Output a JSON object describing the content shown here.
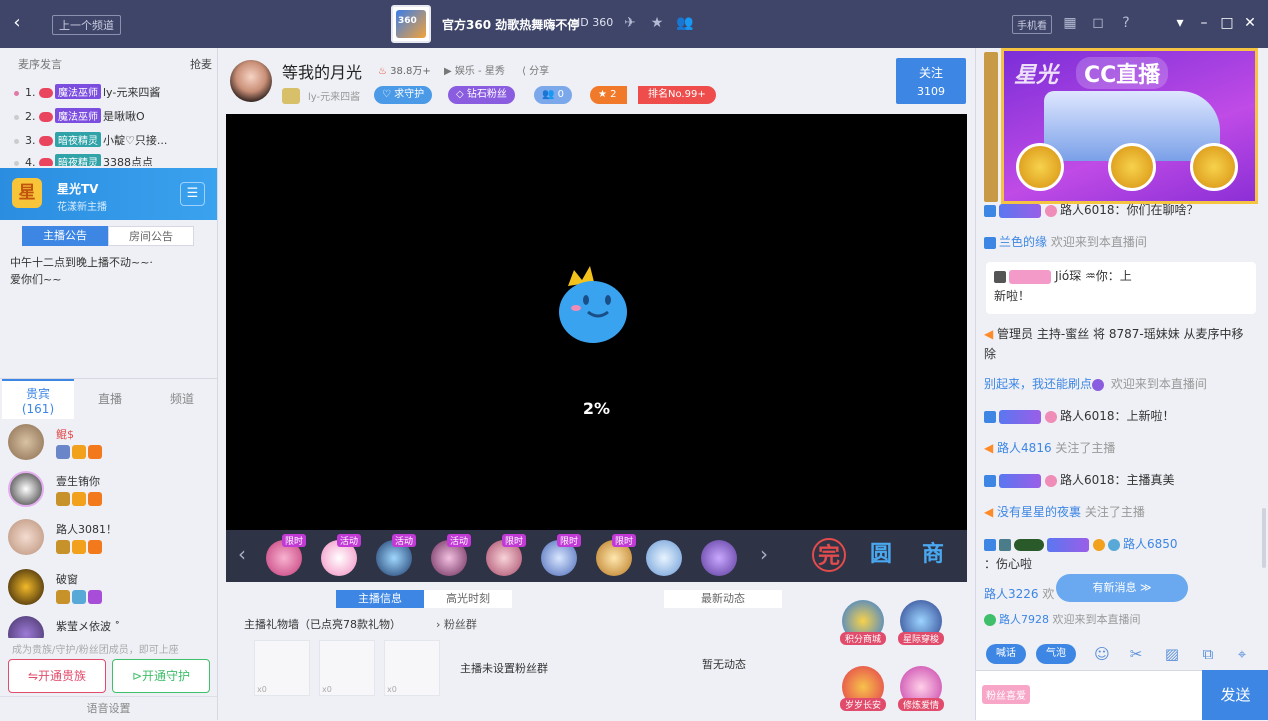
{
  "titlebar": {
    "back_icon": "chevron-left-icon",
    "prev_channel": "上一个频道",
    "logo_text": "360",
    "title": "官方360 劲歌热舞嗨不停",
    "room_id": "ID 360",
    "phone_btn": "手机看",
    "icons": [
      "plane-icon",
      "star-icon",
      "users-icon",
      "grid-icon",
      "bell-icon",
      "help-icon",
      "dropdown-icon",
      "minimize-icon",
      "maximize-icon",
      "close-icon"
    ]
  },
  "left": {
    "rank_header": "麦序发言",
    "rank_grab": "抢麦",
    "rank": [
      {
        "num": "1.",
        "badge": "魔法巫师",
        "name": "ly-元来四酱"
      },
      {
        "num": "2.",
        "badge": "魔法巫师",
        "name": "是啾啾O"
      },
      {
        "num": "3.",
        "badge": "暗夜精灵",
        "name": "小靛♡只接..."
      },
      {
        "num": "4.",
        "badge": "暗夜精灵",
        "name": "3388点点"
      }
    ],
    "banner": {
      "logo": "星",
      "name": "星光TV",
      "sub": "花漾新主播"
    },
    "tabs": [
      "主播公告",
      "房间公告"
    ],
    "notice": "中午十二点到晚上播不动~~·\n爱你们~~",
    "vtabs": [
      {
        "l1": "贵宾",
        "l2": "(161)"
      },
      {
        "l1": "直播"
      },
      {
        "l1": "频道"
      }
    ],
    "members": [
      {
        "name": "鲲$",
        "red": true
      },
      {
        "name": "壹生铕你",
        "red": false
      },
      {
        "name": "路人3081！",
        "red": false
      },
      {
        "name": "破窗",
        "red": false
      },
      {
        "name": "紫莹メ依波 ˚",
        "red": false
      }
    ],
    "join_tip": "成为贵族/守护/粉丝团成员，即可上座",
    "btn_family": "开通贵族",
    "btn_guard": "开通守护",
    "voice": "语音设置"
  },
  "anchor": {
    "name": "等我的月光",
    "hot": "38.8万+",
    "category": "娱乐 - 星秀",
    "share": "分享",
    "sub": "ly-元来四酱",
    "pills": [
      "求守护",
      "钻石粉丝",
      "0",
      "2",
      "排名No.99+"
    ],
    "follow": "关注",
    "follow_count": "3109"
  },
  "video": {
    "progress": "2%"
  },
  "gifts": {
    "tags": [
      "限时",
      "活动",
      "活动",
      "活动",
      "限时",
      "限时",
      "限时"
    ],
    "right_icons": [
      "完",
      "圆",
      "商"
    ]
  },
  "info": {
    "tabs": [
      "主播信息",
      "高光时刻"
    ],
    "gift_wall": "主播礼物墙（已点亮78款礼物）",
    "fans": "粉丝群",
    "no_fan": "主播未设置粉丝群",
    "news_tab": "最新动态",
    "no_news": "暂无动态",
    "thumbs": [
      "x0",
      "x0",
      "x0"
    ]
  },
  "apps": [
    "积分商城",
    "星际穿梭",
    "岁岁长安",
    "修炼爱情"
  ],
  "right": {
    "ad_title": "星光",
    "ad_brand": "CC直播",
    "chat": [
      {
        "pre": "",
        "name": "路人6018：你们在聊啥？",
        "tail": ""
      },
      {
        "pre": "",
        "name": "兰色的缘",
        "tail": " 欢迎来到本直播间"
      }
    ],
    "bubble_line1": "Jió琛 ♒你",
    "bubble_line1b": "：上",
    "bubble_line2": "新啦！",
    "sys_admin": "管理员 主持-蜜丝 将 8787-瑶妹妹 从麦序中移除",
    "chat2": [
      {
        "name": "别起来，我还能刷点",
        "tail": " 欢迎来到本直播间"
      },
      {
        "name": "路人6018：上新啦！",
        "tail": ""
      },
      {
        "name": "路人4816",
        "tail": " 关注了主播"
      },
      {
        "name": "路人6018：主播真美",
        "tail": ""
      },
      {
        "name": "没有星星的夜裏",
        "tail": " 关注了主播"
      },
      {
        "name": "路人6850",
        "tail": "：伤心啦"
      },
      {
        "name": "路人3226",
        "tail": " 欢"
      },
      {
        "name": "路人7928",
        "tail": " 欢迎来到本直播间"
      }
    ],
    "new_msg": "有新消息 ≫",
    "tool_btn1": "喊话",
    "tool_btn2": "气泡",
    "tool_icons": [
      "smile-icon",
      "scissors-icon",
      "image-icon",
      "share-icon",
      "pin-icon"
    ],
    "fan_label": "粉丝喜爱",
    "send": "发送"
  }
}
